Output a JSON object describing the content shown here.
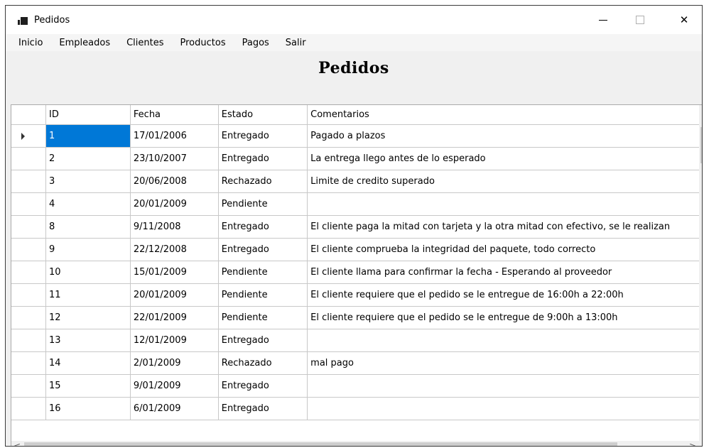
{
  "window": {
    "title": "Pedidos"
  },
  "menu": [
    "Inicio",
    "Empleados",
    "Clientes",
    "Productos",
    "Pagos",
    "Salir"
  ],
  "heading": "Pedidos",
  "grid": {
    "columns": [
      "ID",
      "Fecha",
      "Estado",
      "Comentarios"
    ],
    "rows": [
      [
        "1",
        "17/01/2006",
        "Entregado",
        "Pagado a plazos"
      ],
      [
        "2",
        "23/10/2007",
        "Entregado",
        "La entrega llego antes de lo esperado"
      ],
      [
        "3",
        "20/06/2008",
        "Rechazado",
        "Limite de credito superado"
      ],
      [
        "4",
        "20/01/2009",
        "Pendiente",
        ""
      ],
      [
        "8",
        "9/11/2008",
        "Entregado",
        "El cliente paga la mitad con tarjeta y la otra mitad con efectivo, se le realizan"
      ],
      [
        "9",
        "22/12/2008",
        "Entregado",
        "El cliente comprueba la integridad del paquete, todo correcto"
      ],
      [
        "10",
        "15/01/2009",
        "Pendiente",
        "El cliente llama para confirmar la fecha - Esperando al proveedor"
      ],
      [
        "11",
        "20/01/2009",
        "Pendiente",
        "El cliente requiere que el pedido se le entregue de 16:00h a 22:00h"
      ],
      [
        "12",
        "22/01/2009",
        "Pendiente",
        "El cliente requiere que el pedido se le entregue de 9:00h a 13:00h"
      ],
      [
        "13",
        "12/01/2009",
        "Entregado",
        ""
      ],
      [
        "14",
        "2/01/2009",
        "Rechazado",
        "mal pago"
      ],
      [
        "15",
        "9/01/2009",
        "Entregado",
        ""
      ],
      [
        "16",
        "6/01/2009",
        "Entregado",
        ""
      ]
    ],
    "selected_row": 0
  },
  "colors": {
    "selection": "#0078d7",
    "grid_line": "#c8c8c8",
    "form_bg": "#f0f0f0"
  }
}
